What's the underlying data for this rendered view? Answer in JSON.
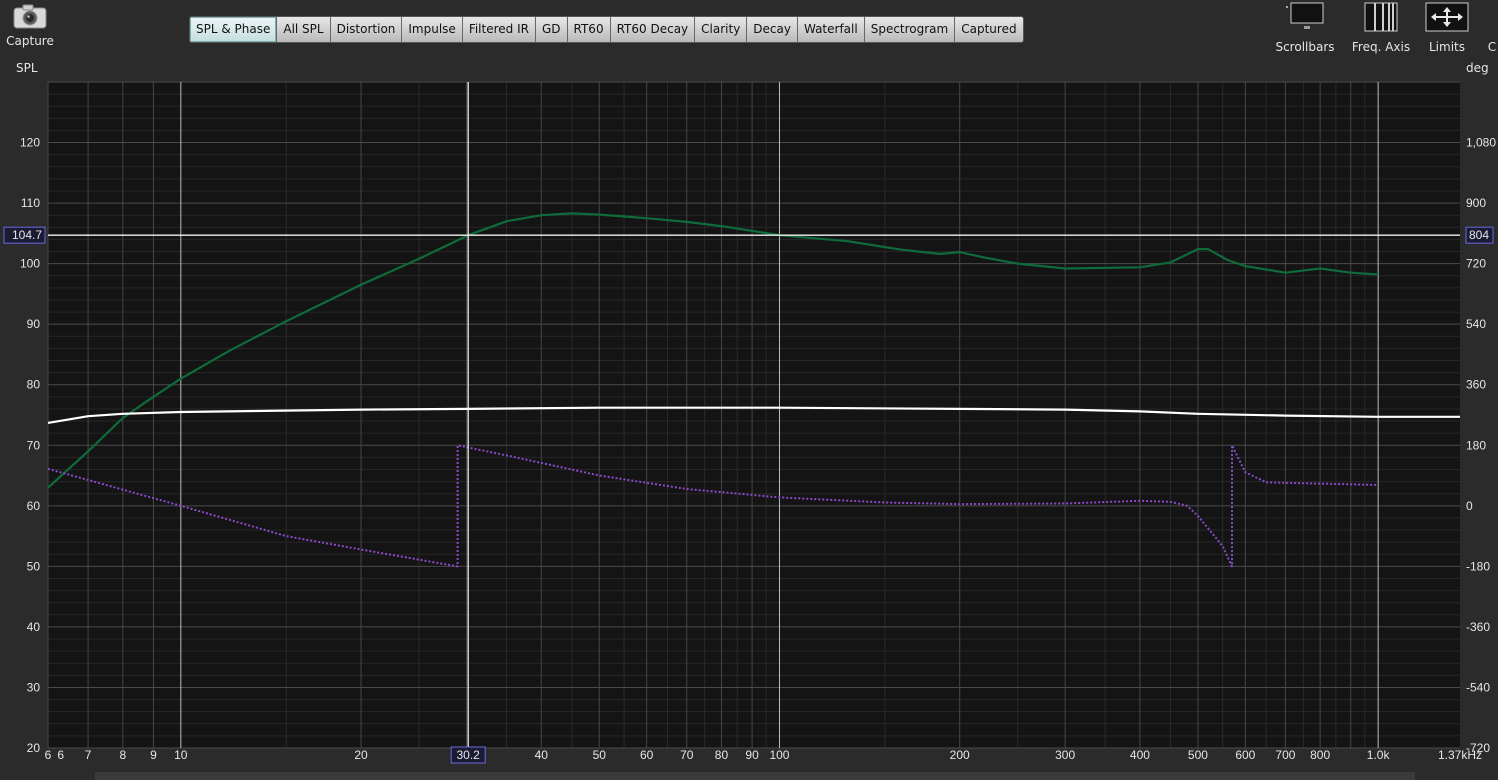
{
  "toolbar": {
    "capture": {
      "label": "Capture",
      "icon": "camera-icon"
    },
    "tabs": [
      {
        "label": "SPL & Phase",
        "active": true
      },
      {
        "label": "All SPL"
      },
      {
        "label": "Distortion"
      },
      {
        "label": "Impulse"
      },
      {
        "label": "Filtered IR"
      },
      {
        "label": "GD"
      },
      {
        "label": "RT60"
      },
      {
        "label": "RT60 Decay"
      },
      {
        "label": "Clarity"
      },
      {
        "label": "Decay"
      },
      {
        "label": "Waterfall"
      },
      {
        "label": "Spectrogram"
      },
      {
        "label": "Captured"
      }
    ],
    "tools": [
      {
        "label": "Scrollbars",
        "icon": "scrollbars-icon"
      },
      {
        "label": "Freq. Axis",
        "icon": "freq-axis-icon"
      },
      {
        "label": "Limits",
        "icon": "limits-arrows-icon"
      },
      {
        "label": "C",
        "icon": ""
      }
    ]
  },
  "colors": {
    "plot_bg": "#141414",
    "spl": "#0f6b3a",
    "phase": "#8a4bc9",
    "reference": "#ffffff",
    "cursor_label": "#6a6adf"
  },
  "chart_data": {
    "type": "line",
    "x_scale": "log",
    "xlim": [
      6,
      1370
    ],
    "left_axis": {
      "label": "SPL",
      "ylim": [
        20,
        130
      ],
      "ticks": [
        20,
        30,
        40,
        50,
        60,
        70,
        80,
        90,
        100,
        110,
        120
      ]
    },
    "right_axis": {
      "label": "deg",
      "ylim": [
        -720,
        1260
      ],
      "ticks": [
        -720,
        -540,
        -360,
        -180,
        0,
        180,
        360,
        540,
        720,
        900,
        1080
      ]
    },
    "right_tick_labels": [
      "-720",
      "-540",
      "-360",
      "-180",
      "0",
      "180",
      "360",
      "540",
      "720",
      "900",
      "1,080"
    ],
    "x_tick_labels": [
      {
        "v": 6,
        "t": "6"
      },
      {
        "v": 6.3,
        "t": "6"
      },
      {
        "v": 7,
        "t": "7"
      },
      {
        "v": 8,
        "t": "8"
      },
      {
        "v": 9,
        "t": "9"
      },
      {
        "v": 10,
        "t": "10"
      },
      {
        "v": 20,
        "t": "20"
      },
      {
        "v": 40,
        "t": "40"
      },
      {
        "v": 50,
        "t": "50"
      },
      {
        "v": 60,
        "t": "60"
      },
      {
        "v": 70,
        "t": "70"
      },
      {
        "v": 80,
        "t": "80"
      },
      {
        "v": 90,
        "t": "90"
      },
      {
        "v": 100,
        "t": "100"
      },
      {
        "v": 200,
        "t": "200"
      },
      {
        "v": 300,
        "t": "300"
      },
      {
        "v": 400,
        "t": "400"
      },
      {
        "v": 500,
        "t": "500"
      },
      {
        "v": 600,
        "t": "600"
      },
      {
        "v": 700,
        "t": "700"
      },
      {
        "v": 800,
        "t": "800"
      },
      {
        "v": 1000,
        "t": "1.0k"
      },
      {
        "v": 1370,
        "t": "1.37kHz"
      }
    ],
    "cursor": {
      "x": 30.2,
      "x_label": "30.2",
      "y_left": 104.7,
      "y_left_label": "104.7",
      "y_right_label": "804"
    },
    "series": [
      {
        "axis": "left",
        "style": "solid",
        "color": "#0f6b3a",
        "points": [
          [
            6,
            63
          ],
          [
            7,
            69
          ],
          [
            8,
            74.5
          ],
          [
            9,
            78
          ],
          [
            10,
            81
          ],
          [
            12,
            85.5
          ],
          [
            15,
            90.5
          ],
          [
            20,
            96.5
          ],
          [
            25,
            100.8
          ],
          [
            30.2,
            104.7
          ],
          [
            35,
            107
          ],
          [
            40,
            108
          ],
          [
            45,
            108.3
          ],
          [
            50,
            108.1
          ],
          [
            60,
            107.5
          ],
          [
            70,
            106.9
          ],
          [
            80,
            106.2
          ],
          [
            100,
            104.7
          ],
          [
            130,
            103.7
          ],
          [
            160,
            102.3
          ],
          [
            185,
            101.6
          ],
          [
            200,
            101.9
          ],
          [
            220,
            101
          ],
          [
            250,
            100
          ],
          [
            300,
            99.2
          ],
          [
            400,
            99.4
          ],
          [
            450,
            100.2
          ],
          [
            500,
            102.4
          ],
          [
            520,
            102.4
          ],
          [
            560,
            100.6
          ],
          [
            600,
            99.6
          ],
          [
            700,
            98.5
          ],
          [
            800,
            99.2
          ],
          [
            900,
            98.5
          ],
          [
            1000,
            98.2
          ]
        ]
      },
      {
        "axis": "left",
        "style": "solid",
        "color": "#ffffff",
        "points": [
          [
            6,
            73.7
          ],
          [
            7,
            74.8
          ],
          [
            8,
            75.2
          ],
          [
            10,
            75.5
          ],
          [
            20,
            75.9
          ],
          [
            30,
            76
          ],
          [
            50,
            76.2
          ],
          [
            100,
            76.2
          ],
          [
            200,
            76
          ],
          [
            300,
            75.9
          ],
          [
            400,
            75.6
          ],
          [
            500,
            75.2
          ],
          [
            700,
            74.9
          ],
          [
            1000,
            74.7
          ],
          [
            1370,
            74.7
          ]
        ]
      },
      {
        "axis": "right",
        "style": "dotted",
        "color": "#8a4bc9",
        "points": [
          [
            6,
            110
          ],
          [
            10,
            0
          ],
          [
            15,
            -90
          ],
          [
            20,
            -130
          ],
          [
            29,
            -180
          ],
          [
            29,
            180
          ],
          [
            35,
            150
          ],
          [
            50,
            90
          ],
          [
            70,
            50
          ],
          [
            100,
            25
          ],
          [
            150,
            10
          ],
          [
            200,
            5
          ],
          [
            300,
            7
          ],
          [
            400,
            15
          ],
          [
            450,
            12
          ],
          [
            480,
            0
          ],
          [
            500,
            -30
          ],
          [
            550,
            -120
          ],
          [
            570,
            -180
          ],
          [
            570,
            180
          ],
          [
            600,
            100
          ],
          [
            650,
            70
          ],
          [
            1000,
            62
          ]
        ]
      }
    ]
  }
}
